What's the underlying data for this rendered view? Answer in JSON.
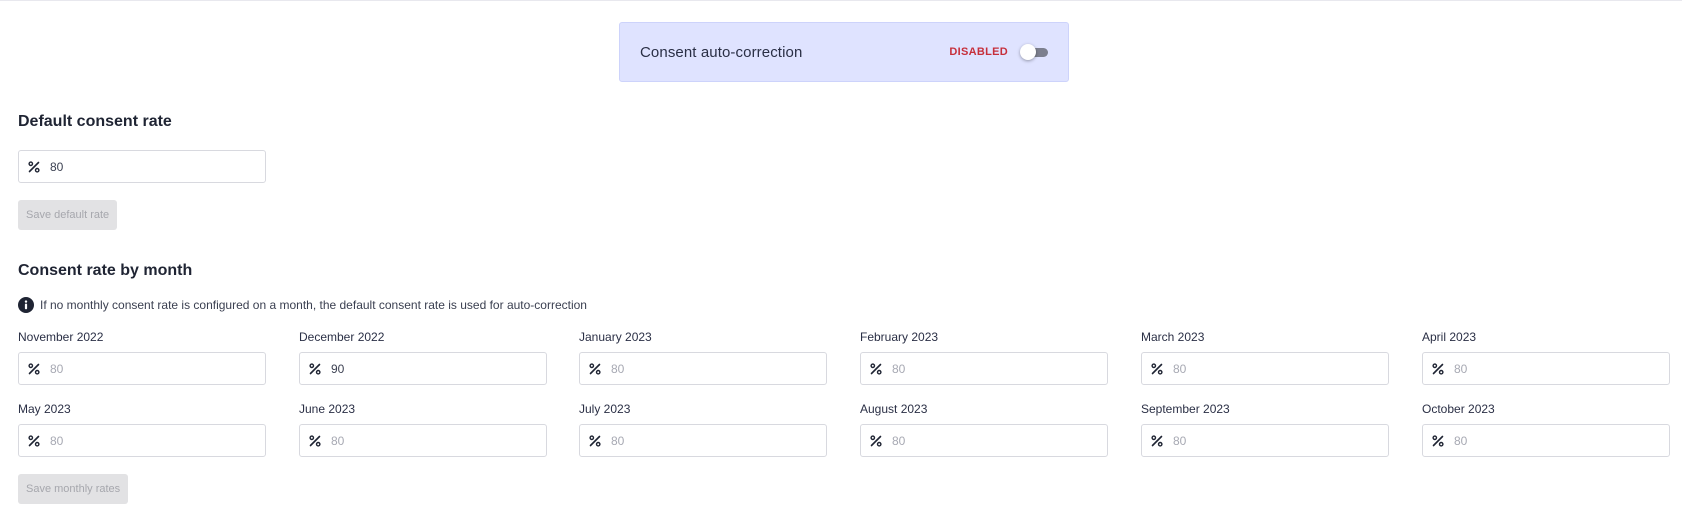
{
  "banner": {
    "title": "Consent auto-correction",
    "status": "DISABLED",
    "status_color": "#c62f3b",
    "background": "#dfe3ff",
    "toggle_on": false
  },
  "default_rate": {
    "title": "Default consent rate",
    "value": "80",
    "icon": "percent-icon",
    "save_label": "Save default rate"
  },
  "monthly": {
    "title": "Consent rate by month",
    "info_icon": "info-icon",
    "info_text": "If no monthly consent rate is configured on a month, the default consent rate is used for auto-correction",
    "months": [
      {
        "label": "November 2022",
        "value": "",
        "placeholder": "80"
      },
      {
        "label": "December 2022",
        "value": "90",
        "placeholder": "80"
      },
      {
        "label": "January 2023",
        "value": "",
        "placeholder": "80"
      },
      {
        "label": "February 2023",
        "value": "",
        "placeholder": "80"
      },
      {
        "label": "March 2023",
        "value": "",
        "placeholder": "80"
      },
      {
        "label": "April 2023",
        "value": "",
        "placeholder": "80"
      },
      {
        "label": "May 2023",
        "value": "",
        "placeholder": "80"
      },
      {
        "label": "June 2023",
        "value": "",
        "placeholder": "80"
      },
      {
        "label": "July 2023",
        "value": "",
        "placeholder": "80"
      },
      {
        "label": "August 2023",
        "value": "",
        "placeholder": "80"
      },
      {
        "label": "September 2023",
        "value": "",
        "placeholder": "80"
      },
      {
        "label": "October 2023",
        "value": "",
        "placeholder": "80"
      }
    ],
    "save_label": "Save monthly rates"
  }
}
